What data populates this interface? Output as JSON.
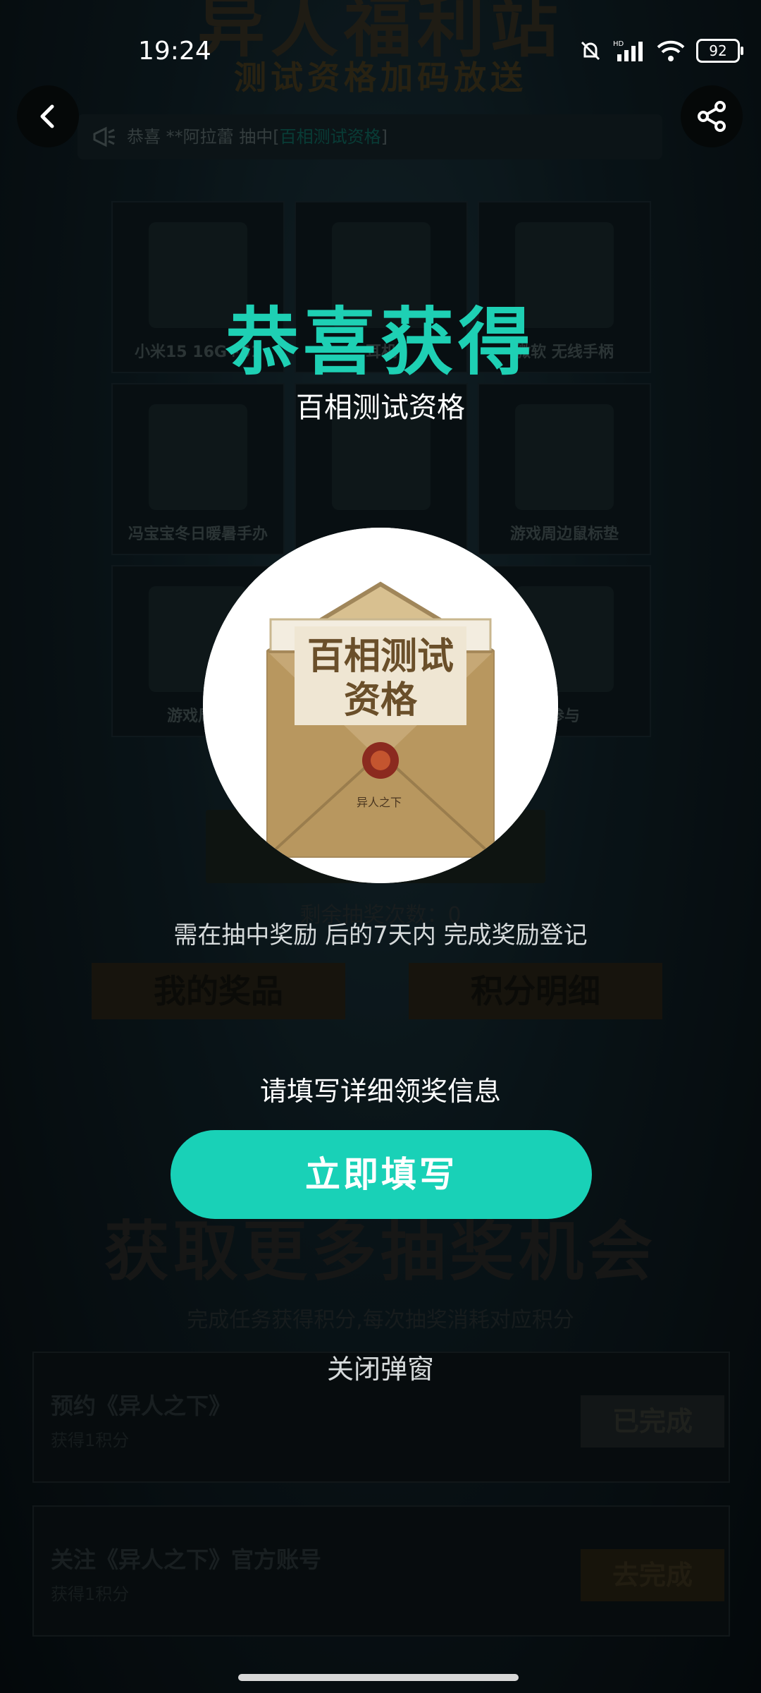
{
  "status_bar": {
    "time": "19:24",
    "battery": "92"
  },
  "background": {
    "title": "异人福利站",
    "subtitle": "测试资格加码放送",
    "ticker": {
      "prefix": "恭喜 **阿拉蕾 抽中[",
      "prize": "百相测试资格",
      "suffix": "]"
    },
    "grid_items": [
      {
        "label": "小米15 16G+51"
      },
      {
        "label": "耳机"
      },
      {
        "label": "微软 无线手柄"
      },
      {
        "label": "冯宝宝冬日暖暑手办"
      },
      {
        "label": ""
      },
      {
        "label": "游戏周边鼠标垫"
      },
      {
        "label": "游戏周边"
      },
      {
        "label": ""
      },
      {
        "label": "参与"
      }
    ],
    "remaining_draws": "剩余抽奖次数：0",
    "my_prizes": "我的奖品",
    "points_detail": "积分明细",
    "more_chances_title": "获取更多抽奖机会",
    "more_chances_sub": "完成任务获得积分,每次抽奖消耗对应积分",
    "tasks": [
      {
        "title": "预约《异人之下》",
        "reward": "获得1积分",
        "button": "已完成"
      },
      {
        "title": "关注《异人之下》官方账号",
        "reward": "获得1积分",
        "button": "去完成"
      }
    ]
  },
  "modal": {
    "congrats": "恭喜获得",
    "prize_name": "百相测试资格",
    "envelope_text_line1": "百相测试",
    "envelope_text_line2": "资格",
    "envelope_brand": "异人之下",
    "deadline_note": "需在抽中奖励 后的7天内 完成奖励登记",
    "fill_info": "请填写详细领奖信息",
    "fill_button": "立即填写",
    "close": "关闭弹窗"
  },
  "colors": {
    "accent": "#19d1b7",
    "congrats": "#1ed0b4"
  }
}
